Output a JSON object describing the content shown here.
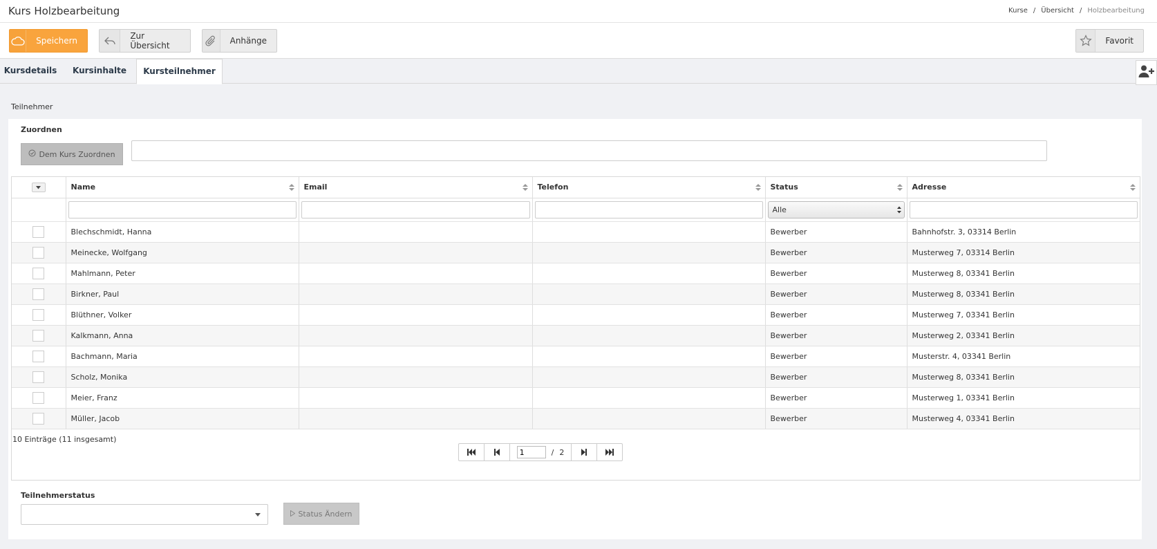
{
  "header": {
    "title": "Kurs Holzbearbeitung",
    "breadcrumb": [
      "Kurse",
      "Übersicht",
      "Holzbearbeitung"
    ]
  },
  "toolbar": {
    "save_label": "Speichern",
    "overview_label": "Zur Übersicht",
    "attachments_label": "Anhänge",
    "favorite_label": "Favorit"
  },
  "tabs": [
    {
      "label": "Kursdetails",
      "active": false
    },
    {
      "label": "Kursinhalte",
      "active": false
    },
    {
      "label": "Kursteilnehmer",
      "active": true
    }
  ],
  "section": {
    "title": "Teilnehmer",
    "assign_label": "Zuordnen",
    "assign_button": "Dem Kurs Zuordnen",
    "assign_input_value": ""
  },
  "table": {
    "columns": [
      "Name",
      "Email",
      "Telefon",
      "Status",
      "Adresse"
    ],
    "status_filter": "Alle",
    "rows": [
      {
        "name": "Blechschmidt, Hanna",
        "email": "",
        "phone": "",
        "status": "Bewerber",
        "address": "Bahnhofstr. 3, 03314 Berlin"
      },
      {
        "name": "Meinecke, Wolfgang",
        "email": "",
        "phone": "",
        "status": "Bewerber",
        "address": "Musterweg 7, 03314 Berlin"
      },
      {
        "name": "Mahlmann, Peter",
        "email": "",
        "phone": "",
        "status": "Bewerber",
        "address": "Musterweg 8, 03341 Berlin"
      },
      {
        "name": "Birkner, Paul",
        "email": "",
        "phone": "",
        "status": "Bewerber",
        "address": "Musterweg 8, 03341 Berlin"
      },
      {
        "name": "Blüthner, Volker",
        "email": "",
        "phone": "",
        "status": "Bewerber",
        "address": "Musterweg 7, 03341 Berlin"
      },
      {
        "name": "Kalkmann, Anna",
        "email": "",
        "phone": "",
        "status": "Bewerber",
        "address": "Musterweg 2, 03341 Berlin"
      },
      {
        "name": "Bachmann, Maria",
        "email": "",
        "phone": "",
        "status": "Bewerber",
        "address": "Musterstr. 4, 03341 Berlin"
      },
      {
        "name": "Scholz, Monika",
        "email": "",
        "phone": "",
        "status": "Bewerber",
        "address": "Musterweg 8, 03341 Berlin"
      },
      {
        "name": "Meier, Franz",
        "email": "",
        "phone": "",
        "status": "Bewerber",
        "address": "Musterweg 1, 03341 Berlin"
      },
      {
        "name": "Müller, Jacob",
        "email": "",
        "phone": "",
        "status": "Bewerber",
        "address": "Musterweg 4, 03341 Berlin"
      }
    ]
  },
  "pager": {
    "summary": "10 Einträge (11 insgesamt)",
    "current_page": "1",
    "separator": "/",
    "total_pages": "2"
  },
  "status_change": {
    "label": "Teilnehmerstatus",
    "selected": "",
    "button": "Status Ändern"
  },
  "colors": {
    "primary": "#f9a43d",
    "tab_text": "#2d3b4a",
    "background": "#f0f1f4"
  },
  "icons": {
    "save": "cloud-icon",
    "overview": "reply-arrow-icon",
    "attachments": "paperclip-icon",
    "favorite": "star-icon",
    "add_user": "user-plus-icon"
  }
}
